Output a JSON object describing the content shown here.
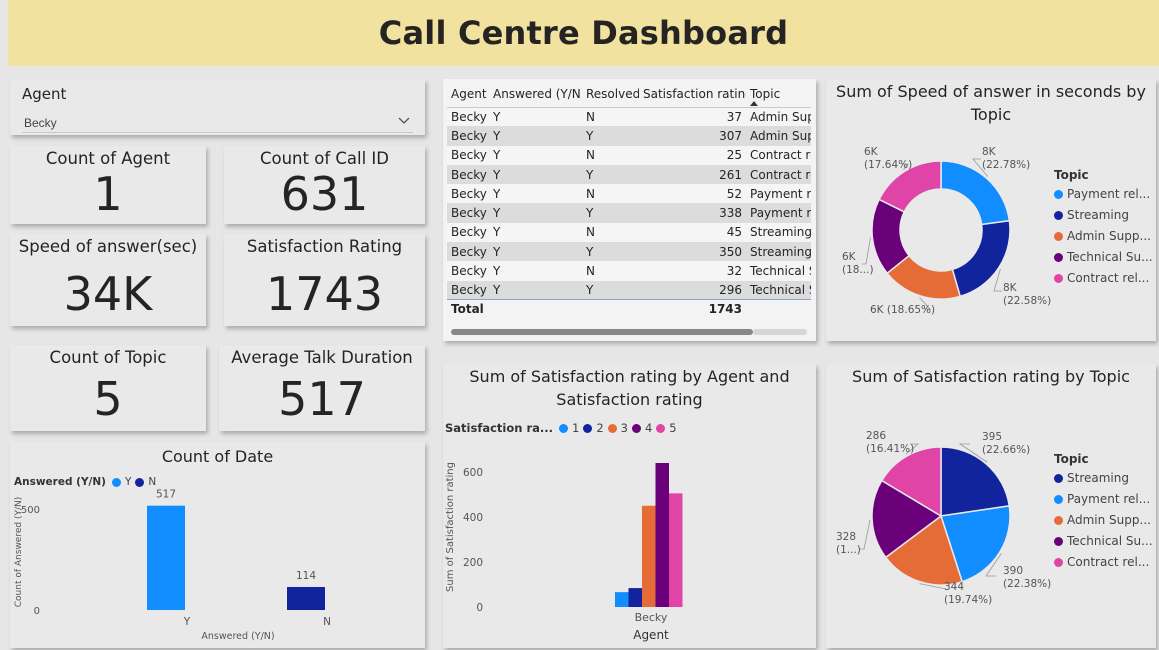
{
  "header": {
    "title": "Call Centre Dashboard"
  },
  "slicer": {
    "label": "Agent",
    "value": "Becky"
  },
  "kpis": [
    {
      "label": "Count of Agent",
      "value": "1"
    },
    {
      "label": "Count of Call ID",
      "value": "631"
    },
    {
      "label": "Speed of answer(sec)",
      "value": "34K"
    },
    {
      "label": "Satisfaction Rating",
      "value": "1743"
    },
    {
      "label": "Count of Topic",
      "value": "5"
    },
    {
      "label": "Average Talk Duration",
      "value": "517"
    }
  ],
  "table": {
    "headers": [
      "Agent",
      "Answered (Y/N)",
      "Resolved",
      "Satisfaction rating",
      "Topic"
    ],
    "rows": [
      [
        "Becky",
        "Y",
        "N",
        "37",
        "Admin Supp"
      ],
      [
        "Becky",
        "Y",
        "Y",
        "307",
        "Admin Supp"
      ],
      [
        "Becky",
        "Y",
        "N",
        "25",
        "Contract rel"
      ],
      [
        "Becky",
        "Y",
        "Y",
        "261",
        "Contract rel"
      ],
      [
        "Becky",
        "Y",
        "N",
        "52",
        "Payment rel"
      ],
      [
        "Becky",
        "Y",
        "Y",
        "338",
        "Payment rel"
      ],
      [
        "Becky",
        "Y",
        "N",
        "45",
        "Streaming"
      ],
      [
        "Becky",
        "Y",
        "Y",
        "350",
        "Streaming"
      ],
      [
        "Becky",
        "Y",
        "N",
        "32",
        "Technical Su"
      ],
      [
        "Becky",
        "Y",
        "Y",
        "296",
        "Technical Su"
      ]
    ],
    "total_label": "Total",
    "total_value": "1743"
  },
  "colors": {
    "light_blue": "#118dff",
    "dark_blue": "#12239e",
    "orange": "#e66c37",
    "purple": "#6b007b",
    "pink": "#e044a7",
    "header_bg": "#f1e29f"
  },
  "icons": {
    "dropdown": "chevron-down-icon",
    "sort": "sort-ascending-icon"
  },
  "chart_data": [
    {
      "type": "donut",
      "title": "Sum of Speed of answer in seconds by Topic",
      "legend_title": "Topic",
      "legend_position": "right",
      "categories": [
        "Payment rel...",
        "Streaming",
        "Admin Supp...",
        "Technical Su...",
        "Contract rel..."
      ],
      "values": [
        7748,
        7678,
        6342,
        6120,
        6000
      ],
      "labels": [
        [
          "8K",
          "(22.78%)"
        ],
        [
          "8K",
          "(22.58%)"
        ],
        [
          "6K (18.65%)",
          ""
        ],
        [
          "6K",
          "(18...)"
        ],
        [
          "6K",
          "(17.64%)"
        ]
      ]
    },
    {
      "type": "bar",
      "title": "Sum of Satisfaction rating by Agent and Satisfaction rating",
      "legend_title": "Satisfaction ra...",
      "legend_position": "top-left",
      "xlabel": "Agent",
      "ylabel": "Sum of Satisfaction rating",
      "categories": [
        "Becky"
      ],
      "series": [
        {
          "name": "1",
          "values": [
            66
          ]
        },
        {
          "name": "2",
          "values": [
            84
          ]
        },
        {
          "name": "3",
          "values": [
            450
          ]
        },
        {
          "name": "4",
          "values": [
            640
          ]
        },
        {
          "name": "5",
          "values": [
            505
          ]
        }
      ],
      "yticks": [
        "0",
        "200",
        "400",
        "600"
      ],
      "ylim": [
        0,
        680
      ]
    },
    {
      "type": "pie",
      "title": "Sum of Satisfaction rating by Topic",
      "legend_title": "Topic",
      "legend_position": "right",
      "categories": [
        "Streaming",
        "Payment rel...",
        "Admin Supp...",
        "Technical Su...",
        "Contract rel..."
      ],
      "values": [
        395,
        390,
        344,
        328,
        286
      ],
      "labels": [
        [
          "395",
          "(22.66%)"
        ],
        [
          "390",
          "(22.38%)"
        ],
        [
          "344",
          "(19.74%)"
        ],
        [
          "328",
          "(1...)"
        ],
        [
          "286",
          "(16.41%)"
        ]
      ]
    },
    {
      "type": "bar",
      "title": "Count of Date",
      "legend_title": "Answered (Y/N)",
      "legend_position": "top-left",
      "xlabel": "Answered (Y/N)",
      "ylabel": "Count of Answered (Y/N)",
      "categories": [
        "Y",
        "N"
      ],
      "values": [
        517,
        114
      ],
      "data_labels": [
        "517",
        "114"
      ],
      "yticks": [
        "0",
        "500"
      ],
      "ylim": [
        0,
        560
      ]
    }
  ]
}
